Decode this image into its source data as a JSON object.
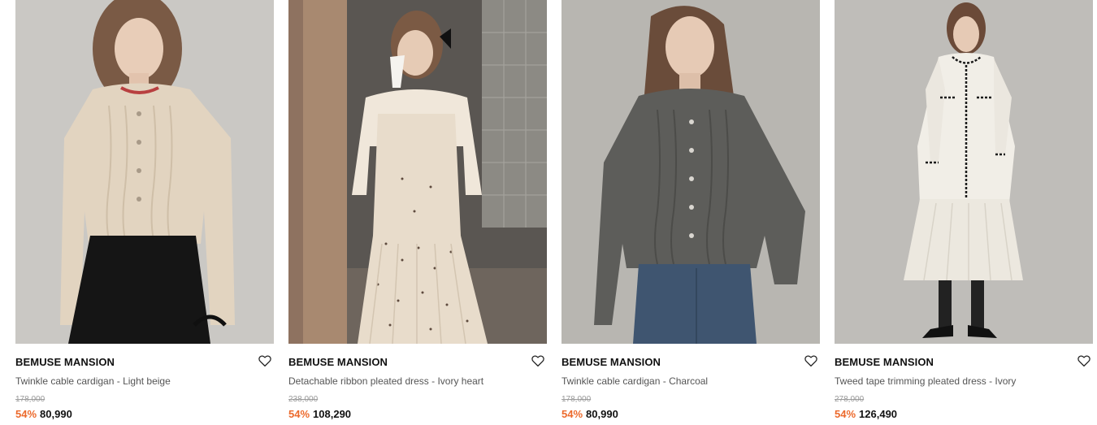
{
  "products": [
    {
      "brand": "BEMUSE MANSION",
      "name": "Twinkle cable cardigan - Light beige",
      "original_price": "178,000",
      "discount": "54%",
      "sale_price": "80,990",
      "photo": "model-wearing-light-beige-cable-cardigan"
    },
    {
      "brand": "BEMUSE MANSION",
      "name": "Detachable ribbon pleated dress - Ivory heart",
      "original_price": "238,000",
      "discount": "54%",
      "sale_price": "108,290",
      "photo": "model-wearing-ivory-pleated-dress-drinking-coffee"
    },
    {
      "brand": "BEMUSE MANSION",
      "name": "Twinkle cable cardigan - Charcoal",
      "original_price": "178,000",
      "discount": "54%",
      "sale_price": "80,990",
      "photo": "model-wearing-charcoal-cable-cardigan-and-jeans"
    },
    {
      "brand": "BEMUSE MANSION",
      "name": "Tweed tape trimming pleated dress - Ivory",
      "original_price": "278,000",
      "discount": "54%",
      "sale_price": "126,490",
      "photo": "model-wearing-ivory-tweed-trim-dress"
    }
  ],
  "icons": {
    "wishlist": "heart-outline-icon"
  },
  "colors": {
    "discount": "#ec6a2c",
    "text": "#111111",
    "muted": "#9a9a9a"
  }
}
